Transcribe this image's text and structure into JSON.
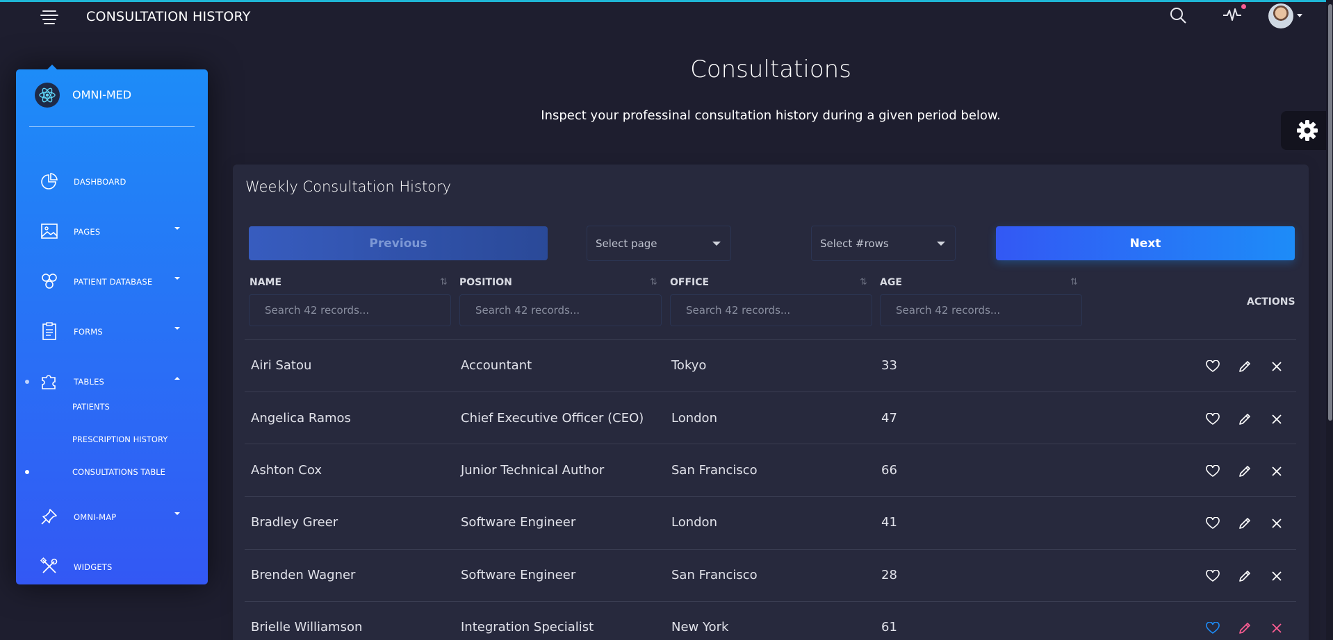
{
  "navbar": {
    "brand": "CONSULTATION HISTORY"
  },
  "sidebar": {
    "logo_text": "OMNI-MED",
    "items": [
      {
        "label": "DASHBOARD",
        "icon": "chart-pie-icon"
      },
      {
        "label": "PAGES",
        "icon": "image-icon"
      },
      {
        "label": "PATIENT DATABASE",
        "icon": "atom-icon"
      },
      {
        "label": "FORMS",
        "icon": "clipboard-icon"
      },
      {
        "label": "TABLES",
        "icon": "puzzle-icon"
      },
      {
        "label": "OMNI-MAP",
        "icon": "pin-icon"
      },
      {
        "label": "WIDGETS",
        "icon": "tools-icon"
      }
    ],
    "sub_items": [
      {
        "label": "PATIENTS"
      },
      {
        "label": "PRESCRIPTION HISTORY"
      },
      {
        "label": "CONSULTATIONS TABLE"
      }
    ]
  },
  "page": {
    "title": "Consultations",
    "description": "Inspect your professinal consultation history during a given period below."
  },
  "card": {
    "title": "Weekly Consultation History",
    "previous_label": "Previous",
    "next_label": "Next",
    "select_page": "Select page",
    "select_rows": "Select #rows",
    "columns": [
      "NAME",
      "POSITION",
      "OFFICE",
      "AGE"
    ],
    "actions_label": "ACTIONS",
    "filter_placeholder": "Search 42 records...",
    "rows": [
      {
        "name": "Airi Satou",
        "position": "Accountant",
        "office": "Tokyo",
        "age": "33"
      },
      {
        "name": "Angelica Ramos",
        "position": "Chief Executive Officer (CEO)",
        "office": "London",
        "age": "47"
      },
      {
        "name": "Ashton Cox",
        "position": "Junior Technical Author",
        "office": "San Francisco",
        "age": "66"
      },
      {
        "name": "Bradley Greer",
        "position": "Software Engineer",
        "office": "London",
        "age": "41"
      },
      {
        "name": "Brenden Wagner",
        "position": "Software Engineer",
        "office": "San Francisco",
        "age": "28"
      },
      {
        "name": "Brielle Williamson",
        "position": "Integration Specialist",
        "office": "New York",
        "age": "61"
      }
    ]
  },
  "colors": {
    "background": "#1e1e2f",
    "card": "#27293d",
    "sidebar_top": "#1d8cf8",
    "sidebar_bottom": "#3358f4",
    "like_active": "#1d8cf8",
    "edit_active": "#fd5d93",
    "remove_active": "#fd5d93"
  }
}
